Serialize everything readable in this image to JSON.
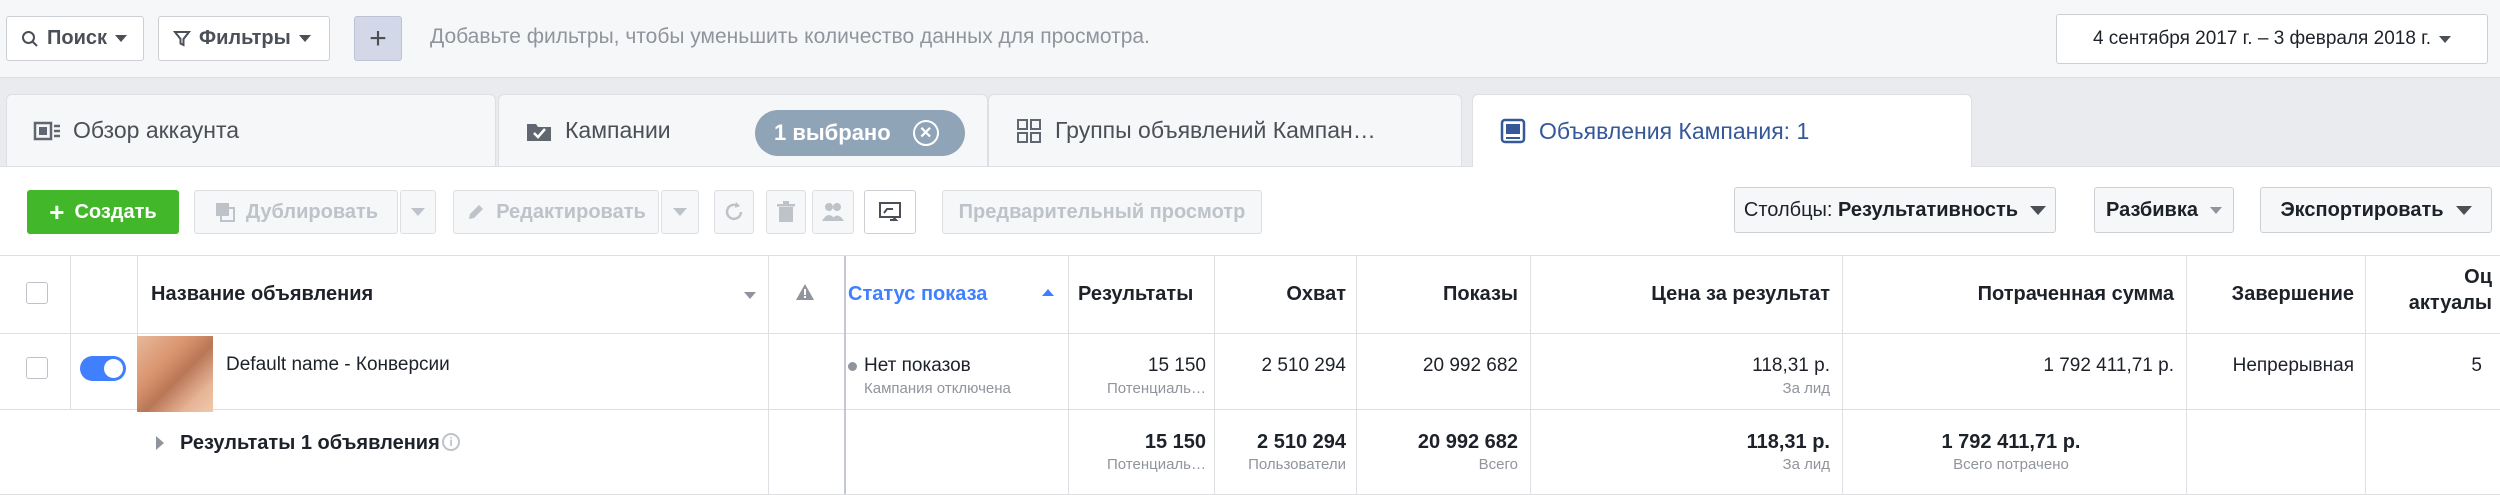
{
  "filterbar": {
    "search_label": "Поиск",
    "filters_label": "Фильтры",
    "add_icon": "plus-icon",
    "hint": "Добавьте фильтры, чтобы уменьшить количество данных для просмотра.",
    "date_range": "4 сентября 2017 г. – 3 февраля 2018 г."
  },
  "tabs": [
    {
      "label": "Обзор аккаунта",
      "icon": "account-overview-icon"
    },
    {
      "label": "Кампании",
      "icon": "folder-check-icon"
    },
    {
      "label": "Группы объявлений Кампан…",
      "icon": "grid-icon"
    },
    {
      "label": "Объявления Кампания: 1",
      "icon": "ad-icon"
    }
  ],
  "selection_pill": "1 выбрано",
  "toolbar": {
    "create": "Создать",
    "duplicate": "Дублировать",
    "edit": "Редактировать",
    "preview": "Предварительный просмотр",
    "columns_prefix": "Столбцы:",
    "columns_value": "Результативность",
    "breakdown": "Разбивка",
    "export": "Экспортировать"
  },
  "table": {
    "headers": {
      "name": "Название объявления",
      "status": "Статус показа",
      "results": "Результаты",
      "reach": "Охват",
      "impressions": "Показы",
      "cost_per_result": "Цена за результат",
      "amount_spent": "Потраченная сумма",
      "ends": "Завершение",
      "relevance_1": "Оц",
      "relevance_2": "актуалы"
    },
    "row": {
      "name": "Default name - Конверсии",
      "status": "Нет показов",
      "status_sub": "Кампания отключена",
      "results": "15 150",
      "results_sub": "Потенциаль…",
      "reach": "2 510 294",
      "impressions": "20 992 682",
      "cost": "118,31 р.",
      "cost_sub": "За лид",
      "spent": "1 792 411,71 р.",
      "ends": "Непрерывная",
      "relevance": "5"
    },
    "summary": {
      "label": "Результаты 1 объявления",
      "results": "15 150",
      "results_sub": "Потенциаль…",
      "reach": "2 510 294",
      "reach_sub": "Пользователи",
      "impressions": "20 992 682",
      "impressions_sub": "Всего",
      "cost": "118,31 р.",
      "cost_sub": "За лид",
      "spent": "1 792 411,71 р.",
      "spent_sub": "Всего потрачено"
    }
  },
  "colors": {
    "accent": "#4080ff",
    "create_green": "#42b72a",
    "link_blue": "#365899",
    "pill": "#90a4b7"
  }
}
